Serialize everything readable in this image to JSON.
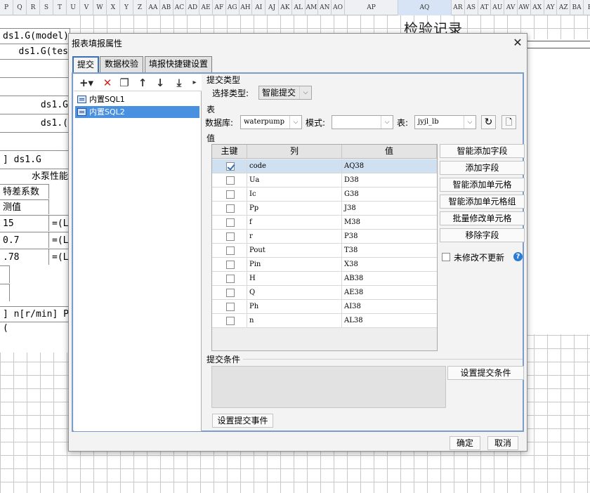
{
  "sheet": {
    "columns": [
      "P",
      "Q",
      "R",
      "S",
      "T",
      "U",
      "V",
      "W",
      "X",
      "Y",
      "Z",
      "AA",
      "AB",
      "AC",
      "AD",
      "AE",
      "AF",
      "AG",
      "AH",
      "AI",
      "AJ",
      "AK",
      "AL",
      "AM",
      "AN",
      "AO",
      "AP",
      "AQ",
      "AR",
      "AS",
      "AT",
      "AU",
      "AV",
      "AW",
      "AX",
      "AY",
      "AZ",
      "BA",
      "B"
    ],
    "selected_column": "AQ",
    "title": "检验记录",
    "left_cells": [
      "ds1.G(model)",
      "ds1.G(tes",
      "",
      "",
      "ds1.G",
      "ds1.(",
      "",
      "] ds1.G",
      "水泵性能",
      "特差系数",
      "测值",
      "15",
      "0.7",
      ".78",
      "",
      "",
      "] n[r/min] P",
      "("
    ],
    "left_formula_cells": [
      "=(L",
      "=(L",
      "=(L"
    ]
  },
  "dialog": {
    "title": "报表填报属性",
    "close_glyph": "✕",
    "tabs": [
      {
        "label": "提交",
        "active": true
      },
      {
        "label": "数据校验",
        "active": false
      },
      {
        "label": "填报快捷键设置",
        "active": false
      }
    ],
    "toolbar_icons": [
      {
        "name": "add-icon",
        "glyph": "+▾",
        "color": "#222222"
      },
      {
        "name": "delete-icon",
        "glyph": "✕",
        "color": "#d42020"
      },
      {
        "name": "copy-icon",
        "glyph": "❐",
        "color": "#333333"
      },
      {
        "name": "move-up-icon",
        "glyph": "↑",
        "color": "#333333"
      },
      {
        "name": "move-down-icon",
        "glyph": "↓",
        "color": "#333333"
      },
      {
        "name": "move-bottom-icon",
        "glyph": "⤓",
        "color": "#333333"
      }
    ],
    "datasources": [
      {
        "label": "内置SQL1",
        "selected": false
      },
      {
        "label": "内置SQL2",
        "selected": true
      }
    ],
    "submit_type": {
      "group_title": "提交类型",
      "select_label": "选择类型:",
      "value": "智能提交"
    },
    "table_group": {
      "group_title": "表",
      "db_label": "数据库:",
      "db_value": "waterpump",
      "mode_label": "模式:",
      "mode_value": "",
      "table_label": "表:",
      "table_value": "jyjl_lb"
    },
    "value_group": {
      "group_title": "值",
      "headers": [
        "主键",
        "列",
        "值"
      ],
      "rows": [
        {
          "key": true,
          "column": "code",
          "value": "AQ38",
          "selected": true
        },
        {
          "key": false,
          "column": "Ua",
          "value": "D38",
          "selected": false
        },
        {
          "key": false,
          "column": "Ic",
          "value": "G38",
          "selected": false
        },
        {
          "key": false,
          "column": "Pp",
          "value": "J38",
          "selected": false
        },
        {
          "key": false,
          "column": "f",
          "value": "M38",
          "selected": false
        },
        {
          "key": false,
          "column": "r",
          "value": "P38",
          "selected": false
        },
        {
          "key": false,
          "column": "Pout",
          "value": "T38",
          "selected": false
        },
        {
          "key": false,
          "column": "Pin",
          "value": "X38",
          "selected": false
        },
        {
          "key": false,
          "column": "H",
          "value": "AB38",
          "selected": false
        },
        {
          "key": false,
          "column": "Q",
          "value": "AE38",
          "selected": false
        },
        {
          "key": false,
          "column": "Ph",
          "value": "AI38",
          "selected": false
        },
        {
          "key": false,
          "column": "n",
          "value": "AL38",
          "selected": false
        }
      ],
      "buttons": [
        "智能添加字段",
        "添加字段",
        "智能添加单元格",
        "智能添加单元格组",
        "批量修改单元格",
        "移除字段"
      ],
      "no_update_label": "未修改不更新",
      "no_update_checked": false
    },
    "condition_group": {
      "group_title": "提交条件",
      "set_condition_button": "设置提交条件"
    },
    "set_event_button": "设置提交事件",
    "ok_button": "确定",
    "cancel_button": "取消"
  }
}
